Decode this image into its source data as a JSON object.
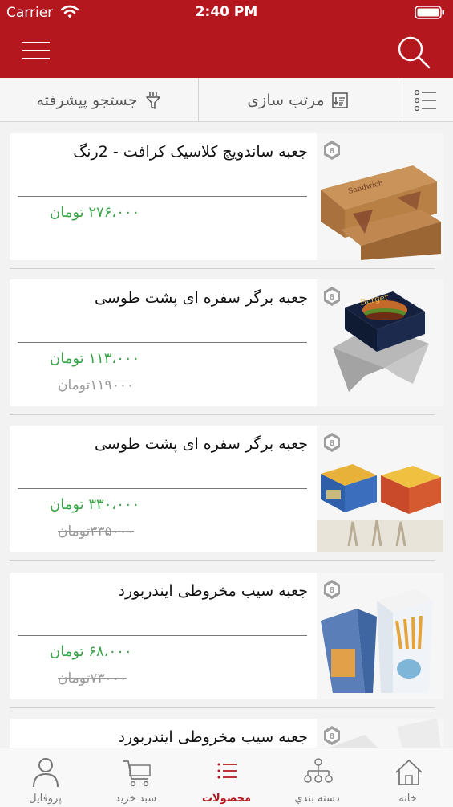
{
  "status_bar": {
    "carrier": "Carrier",
    "time": "2:40 PM"
  },
  "header": {
    "menu_icon": "hamburger-icon",
    "search_icon": "search-icon"
  },
  "filter_bar": {
    "list_icon": "list-view-icon",
    "sort_label": "مرتب سازی",
    "sort_icon": "sort-icon",
    "advanced_label": "جستجو پیشرفته",
    "advanced_icon": "filter-icon"
  },
  "products": [
    {
      "title": "جعبه ساندویچ کلاسیک کرافت - 2رنگ",
      "price": "۲۷۶،۰۰۰ تومان",
      "old_price": ""
    },
    {
      "title": "جعبه برگر سفره ای پشت طوسی",
      "price": "۱۱۳،۰۰۰ تومان",
      "old_price": "۱۱۹۰۰۰تومان"
    },
    {
      "title": "جعبه برگر سفره ای پشت طوسی",
      "price": "۳۳۰،۰۰۰ تومان",
      "old_price": "۳۳۵۰۰۰تومان"
    },
    {
      "title": "جعبه سیب مخروطی ایندربورد",
      "price": "۶۸،۰۰۰ تومان",
      "old_price": "۷۳۰۰۰تومان"
    },
    {
      "title": "جعبه سیب مخروطی ایندربورد",
      "price": "",
      "old_price": ""
    }
  ],
  "bottom_nav": {
    "tabs": [
      {
        "label": "پروفایل",
        "icon": "user-icon"
      },
      {
        "label": "سبد خرید",
        "icon": "cart-icon"
      },
      {
        "label": "محصولات",
        "icon": "list-icon"
      },
      {
        "label": "دسته بندي",
        "icon": "category-tree-icon"
      },
      {
        "label": "خانه",
        "icon": "home-icon"
      }
    ],
    "active_tab": "محصولات"
  },
  "colors": {
    "primary": "#b5171e",
    "price": "#3aa34a",
    "old_price": "#9a9a9a"
  }
}
